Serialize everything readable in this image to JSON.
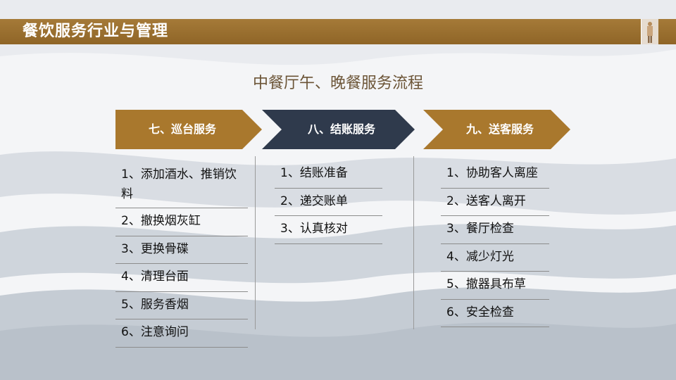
{
  "header": {
    "title": "餐饮服务行业与管理"
  },
  "page_title": "中餐厅午、晚餐服务流程",
  "steps": [
    {
      "label": "七、巡台服务",
      "color": "#a9782d"
    },
    {
      "label": "八、结账服务",
      "color": "#2f3a4c"
    },
    {
      "label": "九、送客服务",
      "color": "#a9782d"
    }
  ],
  "lists": {
    "col1": [
      "1、添加酒水、推销饮料",
      "2、撤换烟灰缸",
      "3、更换骨碟",
      "4、清理台面",
      "5、服务香烟",
      "6、注意询问"
    ],
    "col2": [
      "1、结账准备",
      "2、递交账单",
      "3、认真核对"
    ],
    "col3": [
      "1、协助客人离座",
      "2、送客人离开",
      "3、餐厅检查",
      "4、减少灯光",
      "5、撤器具布草",
      "6、安全检查"
    ]
  }
}
